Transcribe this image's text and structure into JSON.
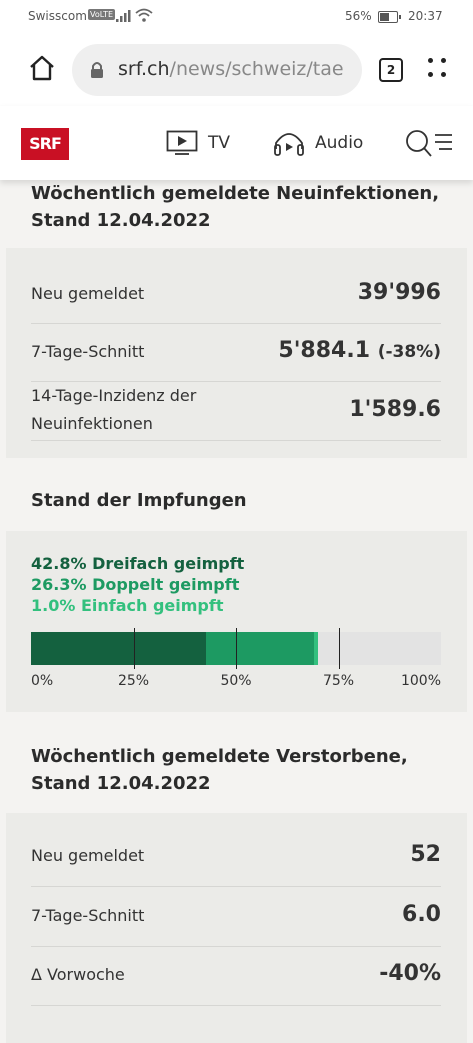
{
  "status_bar": {
    "carrier": "Swisscom",
    "volte": "VoLTE",
    "battery": "56%",
    "time": "20:37"
  },
  "browser": {
    "url_domain": "srf.ch",
    "url_path": "/news/schweiz/tae",
    "tab_count": "2"
  },
  "nav": {
    "logo": "SRF",
    "tv_label": "TV",
    "audio_label": "Audio"
  },
  "infections": {
    "title_line1": "Wöchentlich gemeldete Neuinfektionen,",
    "title_line2": "Stand 12.04.2022",
    "rows": [
      {
        "label": "Neu gemeldet",
        "value": "39'996"
      },
      {
        "label": "7-Tage-Schnitt",
        "value": "5'884.1",
        "change": "(-38%)"
      },
      {
        "label_line1": "14-Tage-Inzidenz der",
        "label_line2": "Neuinfektionen",
        "value": "1'589.6"
      }
    ]
  },
  "vaccinations": {
    "title": "Stand der Impfungen",
    "legend": [
      {
        "text": "42.8% Dreifach geimpft",
        "color": "#14613f"
      },
      {
        "text": "26.3% Doppelt geimpft",
        "color": "#1d9a62"
      },
      {
        "text": "1.0% Einfach geimpft",
        "color": "#33c07e"
      }
    ],
    "bar": [
      {
        "name": "Dreifach geimpft",
        "percent": 42.8,
        "color": "#14613f"
      },
      {
        "name": "Doppelt geimpft",
        "percent": 26.3,
        "color": "#1d9a62"
      },
      {
        "name": "Einfach geimpft",
        "percent": 1.0,
        "color": "#33c07e"
      }
    ],
    "axis_ticks": [
      "0%",
      "25%",
      "50%",
      "75%",
      "100%"
    ]
  },
  "deaths": {
    "title_line1": "Wöchentlich gemeldete Verstorbene,",
    "title_line2": "Stand 12.04.2022",
    "rows": [
      {
        "label": "Neu gemeldet",
        "value": "52"
      },
      {
        "label": "7-Tage-Schnitt",
        "value": "6.0"
      },
      {
        "label": "Δ Vorwoche",
        "value": "-40%"
      }
    ]
  }
}
